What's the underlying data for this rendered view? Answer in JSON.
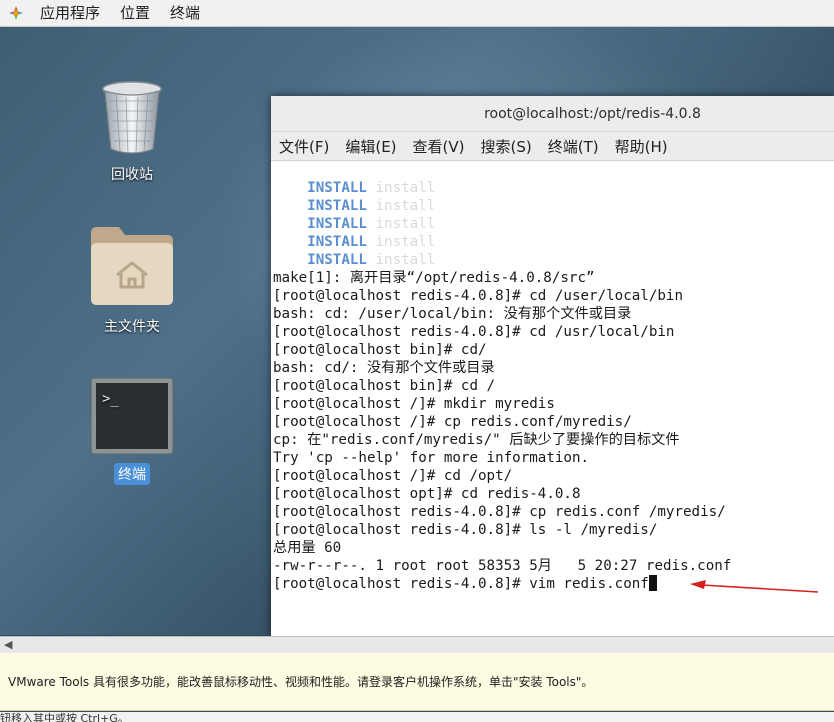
{
  "topbar": {
    "menus": [
      "应用程序",
      "位置",
      "终端"
    ]
  },
  "desktop": {
    "icons": [
      {
        "label": "回收站",
        "icon": "trash-icon"
      },
      {
        "label": "主文件夹",
        "icon": "home-folder-icon"
      },
      {
        "label": "终端",
        "icon": "terminal-icon",
        "selected": true
      }
    ]
  },
  "terminal": {
    "title": "root@localhost:/opt/redis-4.0.8",
    "menus": [
      "文件(F)",
      "编辑(E)",
      "查看(V)",
      "搜索(S)",
      "终端(T)",
      "帮助(H)"
    ],
    "install_lines": [
      {
        "kw": "INSTALL",
        "arg": "install"
      },
      {
        "kw": "INSTALL",
        "arg": "install"
      },
      {
        "kw": "INSTALL",
        "arg": "install"
      },
      {
        "kw": "INSTALL",
        "arg": "install"
      },
      {
        "kw": "INSTALL",
        "arg": "install"
      }
    ],
    "lines": [
      "make[1]: 离开目录“/opt/redis-4.0.8/src”",
      "[root@localhost redis-4.0.8]# cd /user/local/bin",
      "bash: cd: /user/local/bin: 没有那个文件或目录",
      "[root@localhost redis-4.0.8]# cd /usr/local/bin",
      "[root@localhost bin]# cd/",
      "bash: cd/: 没有那个文件或目录",
      "[root@localhost bin]# cd /",
      "[root@localhost /]# mkdir myredis",
      "[root@localhost /]# cp redis.conf/myredis/",
      "cp: 在\"redis.conf/myredis/\" 后缺少了要操作的目标文件",
      "Try 'cp --help' for more information.",
      "[root@localhost /]# cd /opt/",
      "[root@localhost opt]# cd redis-4.0.8",
      "[root@localhost redis-4.0.8]# cp redis.conf /myredis/",
      "[root@localhost redis-4.0.8]# ls -l /myredis/",
      "总用量 60",
      "-rw-r--r--. 1 root root 58353 5月   5 20:27 redis.conf"
    ],
    "current_line": "[root@localhost redis-4.0.8]# vim redis.conf"
  },
  "vmware": {
    "notice": "VMware Tools 具有很多功能，能改善鼠标移动性、视频和性能。请登录客户机操作系统，单击\"安装 Tools\"。",
    "status": "钮移入其中或按 Ctrl+G。"
  },
  "colors": {
    "annotation_arrow": "#d42020",
    "install_keyword": "#5b8fd0",
    "selected_label": "#4a90d9"
  }
}
